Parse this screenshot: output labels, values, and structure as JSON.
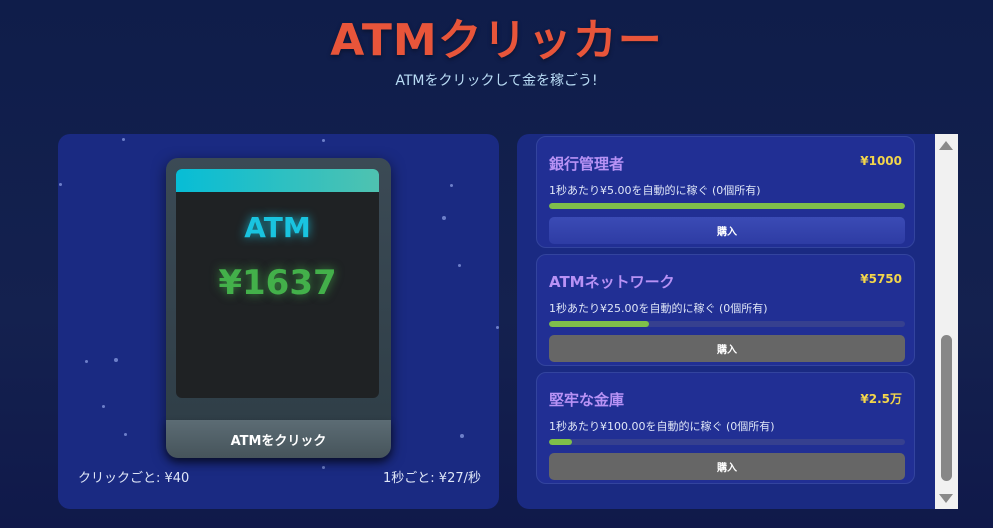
{
  "header": {
    "title": "ATMクリッカー",
    "subtitle": "ATMをクリックして金を稼ごう!"
  },
  "atm": {
    "screen_label": "ATM",
    "balance": "¥1637",
    "click_button_label": "ATMをクリック"
  },
  "stats": {
    "per_click": "クリックごと: ¥40",
    "per_second": "1秒ごと: ¥27/秒"
  },
  "upgrades": [
    {
      "name": "銀行管理者",
      "price": "¥1000",
      "description": "1秒あたり¥5.00を自動的に稼ぐ (0個所有)",
      "progress": 1.0,
      "buy_label": "購入",
      "affordable": true
    },
    {
      "name": "ATMネットワーク",
      "price": "¥5750",
      "description": "1秒あたり¥25.00を自動的に稼ぐ (0個所有)",
      "progress": 0.28,
      "buy_label": "購入",
      "affordable": false
    },
    {
      "name": "堅牢な金庫",
      "price": "¥2.5万",
      "description": "1秒あたり¥100.00を自動的に稼ぐ (0個所有)",
      "progress": 0.065,
      "buy_label": "購入",
      "affordable": false
    }
  ],
  "colors": {
    "title": "#e8553a",
    "upgrade_name": "#b892f5",
    "price": "#f2d54b",
    "balance": "#43b04a",
    "screen_label": "#19c4e0",
    "progress_fill": "#7fbf4a"
  }
}
